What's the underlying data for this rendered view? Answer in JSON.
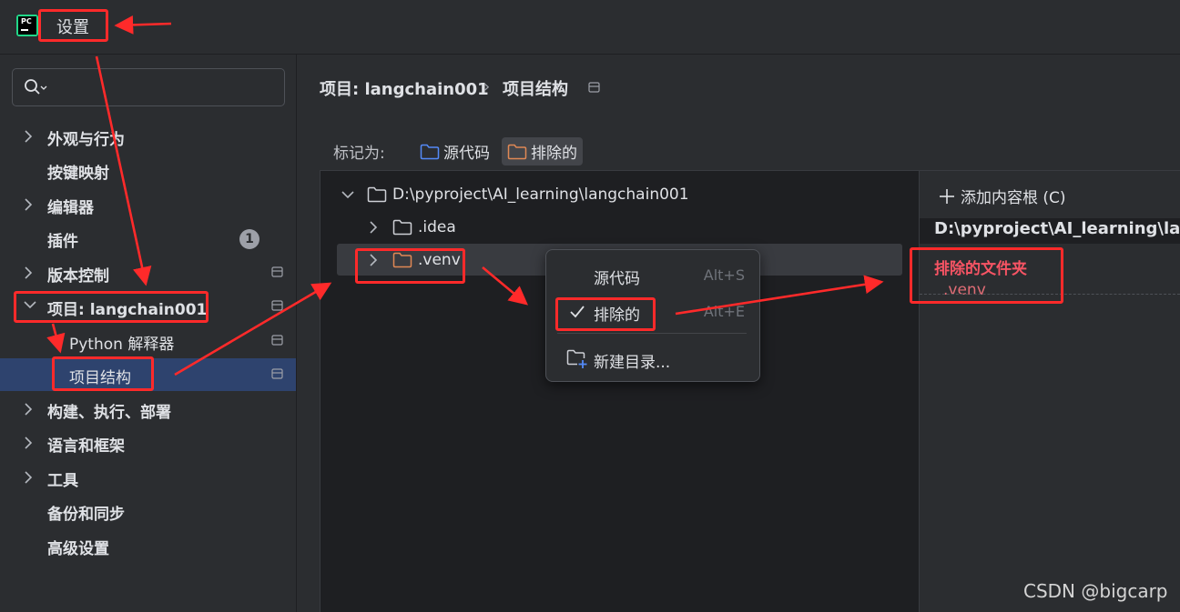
{
  "window": {
    "title": "设置",
    "logo_text": "PC"
  },
  "search": {
    "placeholder": "",
    "icon": "search-icon"
  },
  "sidebar": {
    "items": [
      {
        "label": "外观与行为",
        "expandable": true
      },
      {
        "label": "按键映射",
        "expandable": false
      },
      {
        "label": "编辑器",
        "expandable": true
      },
      {
        "label": "插件",
        "expandable": false,
        "badge": "1"
      },
      {
        "label": "版本控制",
        "expandable": true
      },
      {
        "label": "项目: langchain001",
        "expandable": true,
        "expanded": true
      },
      {
        "label": "Python 解释器",
        "expandable": false
      },
      {
        "label": "项目结构",
        "expandable": false,
        "selected": true
      },
      {
        "label": "构建、执行、部署",
        "expandable": true
      },
      {
        "label": "语言和框架",
        "expandable": true
      },
      {
        "label": "工具",
        "expandable": true
      },
      {
        "label": "备份和同步",
        "expandable": false
      },
      {
        "label": "高级设置",
        "expandable": false
      }
    ]
  },
  "breadcrumb": {
    "project": "项目: langchain001",
    "separator": "›",
    "page": "项目结构"
  },
  "mark_as": {
    "label": "标记为:",
    "buttons": [
      {
        "label": "源代码",
        "icon": "source-folder-icon",
        "color": "#548af7"
      },
      {
        "label": "排除的",
        "icon": "excluded-folder-icon",
        "color": "#e08855",
        "active": true
      }
    ]
  },
  "tree": {
    "root": "D:\\pyproject\\AI_learning\\langchain001",
    "children": [
      ".idea",
      ".venv"
    ]
  },
  "context_menu": {
    "items": [
      {
        "label": "源代码",
        "shortcut": "Alt+S",
        "checked": false
      },
      {
        "label": "排除的",
        "shortcut": "Alt+E",
        "checked": true
      },
      {
        "label": "新建目录...",
        "shortcut": "",
        "icon": "new-folder-icon"
      }
    ]
  },
  "right_panel": {
    "add_root": "添加内容根 (C)",
    "root_path": "D:\\pyproject\\AI_learning\\lang",
    "excluded_header": "排除的文件夹",
    "excluded_item": ".venv"
  },
  "watermark": "CSDN @bigcarp",
  "colors": {
    "accent": "#2e436e",
    "annotation": "#ff2a2a",
    "excluded": "#f75464"
  }
}
